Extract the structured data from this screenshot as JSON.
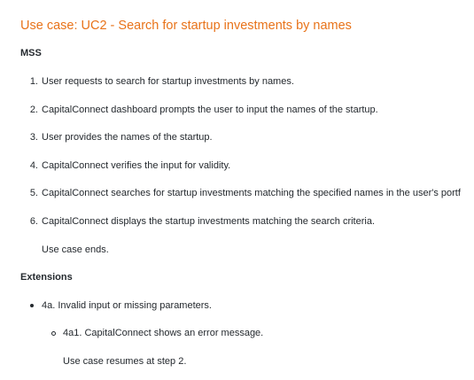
{
  "section": {
    "title": "Use case: UC2 - Search for startup investments by names",
    "mss_heading": "MSS",
    "mss_steps": [
      {
        "num": "1.",
        "text": "User requests to search for startup investments by names."
      },
      {
        "num": "2.",
        "text": "CapitalConnect dashboard prompts the user to input the names of the startup."
      },
      {
        "num": "3.",
        "text": "User provides the names of the startup."
      },
      {
        "num": "4.",
        "text": "CapitalConnect verifies the input for validity."
      },
      {
        "num": "5.",
        "text": "CapitalConnect searches for startup investments matching the specified names in the user's portf"
      },
      {
        "num": "6.",
        "text": "CapitalConnect displays the startup investments matching the search criteria."
      }
    ],
    "mss_end": "Use case ends.",
    "extensions_heading": "Extensions",
    "extensions": [
      {
        "text": "4a. Invalid input or missing parameters.",
        "sub": [
          {
            "text": "4a1. CapitalConnect shows an error message."
          }
        ],
        "resume": "Use case resumes at step 2."
      }
    ]
  }
}
